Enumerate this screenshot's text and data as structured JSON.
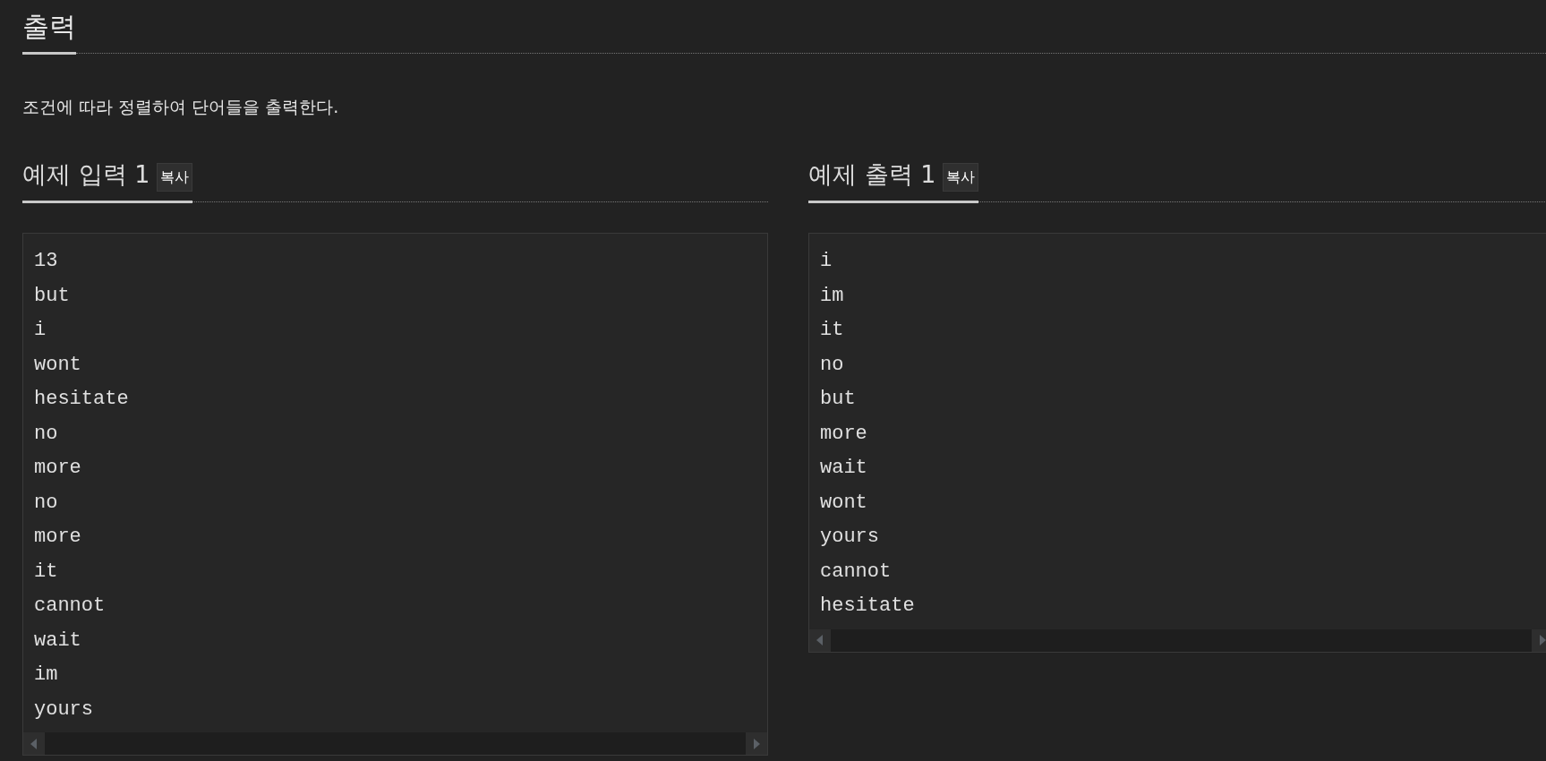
{
  "section": {
    "title": "출력",
    "description": "조건에 따라 정렬하여 단어들을 출력한다."
  },
  "samples": [
    {
      "title": "예제 입력 1",
      "copy_button": "복사",
      "lines": [
        "13",
        "but",
        "i",
        "wont",
        "hesitate",
        "no",
        "more",
        "no",
        "more",
        "it",
        "cannot",
        "wait",
        "im",
        "yours"
      ]
    },
    {
      "title": "예제 출력 1",
      "copy_button": "복사",
      "lines": [
        "i",
        "im",
        "it",
        "no",
        "but",
        "more",
        "wait",
        "wont",
        "yours",
        "cannot",
        "hesitate"
      ]
    }
  ]
}
